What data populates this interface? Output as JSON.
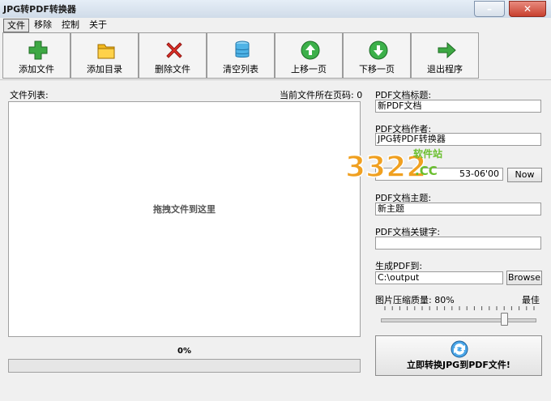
{
  "window": {
    "title": "JPG转PDF转换器"
  },
  "menu": [
    "文件",
    "移除",
    "控制",
    "关于"
  ],
  "toolbar": [
    {
      "label": "添加文件",
      "icon": "plus-icon"
    },
    {
      "label": "添加目录",
      "icon": "folder-icon"
    },
    {
      "label": "删除文件",
      "icon": "delete-x-icon"
    },
    {
      "label": "清空列表",
      "icon": "clear-list-icon"
    },
    {
      "label": "上移一页",
      "icon": "arrow-up-icon"
    },
    {
      "label": "下移一页",
      "icon": "arrow-down-icon"
    },
    {
      "label": "退出程序",
      "icon": "exit-arrow-icon"
    }
  ],
  "file_list": {
    "label": "文件列表:",
    "current_page_label": "当前文件所在页码: 0",
    "drop_hint": "拖拽文件到这里"
  },
  "progress": {
    "text": "0%",
    "value": 0
  },
  "pdf": {
    "title_label": "PDF文档标题:",
    "title_value": "新PDF文档",
    "author_label": "PDF文档作者:",
    "author_value": "JPG转PDF转换器",
    "date_value": "53-06'00",
    "now_button": "Now",
    "subject_label": "PDF文档主题:",
    "subject_value": "新主题",
    "keywords_label": "PDF文档关键字:",
    "keywords_value": "",
    "output_label": "生成PDF到:",
    "output_value": "C:\\output",
    "browse_button": "Browse"
  },
  "quality": {
    "label": "图片压缩质量: 80%",
    "max_label": "最佳",
    "value": 0.8
  },
  "convert_button": "立即转换JPG到PDF文件!",
  "watermark": {
    "number": "3322",
    "tag": "软件站",
    "domain": ".CC"
  },
  "colors": {
    "accent_green": "#2e9d3a",
    "watermark_orange": "#f0a020",
    "watermark_green": "#6abf2e"
  }
}
